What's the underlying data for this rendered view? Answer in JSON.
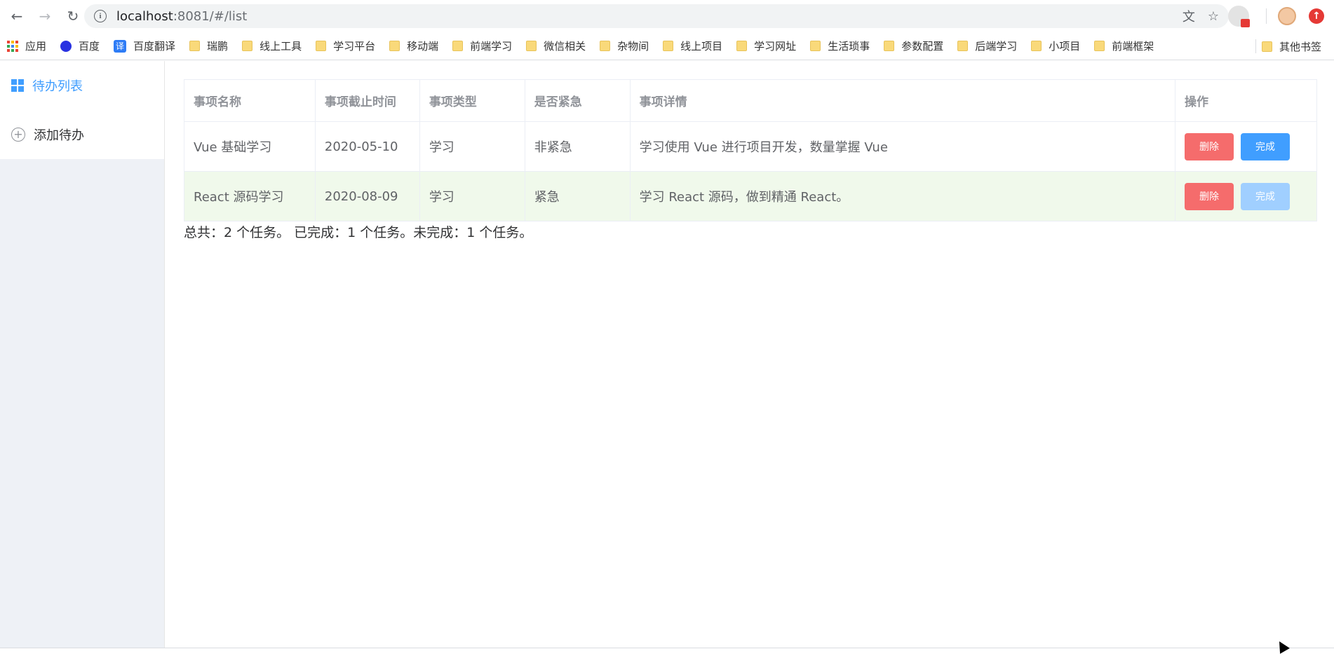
{
  "browser": {
    "url_host": "localhost",
    "url_rest": ":8081/#/list",
    "icons": [
      "back-icon",
      "forward-icon",
      "reload-icon",
      "info-icon",
      "translate-icon",
      "star-icon"
    ]
  },
  "bookmarks": {
    "apps": "应用",
    "items": [
      "百度",
      "百度翻译",
      "瑞鹏",
      "线上工具",
      "学习平台",
      "移动端",
      "前端学习",
      "微信相关",
      "杂物间",
      "线上项目",
      "学习网址",
      "生活琐事",
      "参数配置",
      "后端学习",
      "小项目",
      "前端框架"
    ],
    "other": "其他书签"
  },
  "sidebar": {
    "items": [
      {
        "label": "待办列表",
        "active": true
      },
      {
        "label": "添加待办",
        "active": false
      }
    ]
  },
  "table": {
    "headers": [
      "事项名称",
      "事项截止时间",
      "事项类型",
      "是否紧急",
      "事项详情",
      "操作"
    ],
    "rows": [
      {
        "name": "Vue 基础学习",
        "deadline": "2020-05-10",
        "type": "学习",
        "urgent": "非紧急",
        "detail": "学习使用 Vue 进行项目开发，数量掌握 Vue",
        "done": false
      },
      {
        "name": "React 源码学习",
        "deadline": "2020-08-09",
        "type": "学习",
        "urgent": "紧急",
        "detail": "学习 React 源码，做到精通 React。",
        "done": true
      }
    ],
    "delete_label": "删除",
    "complete_label": "完成"
  },
  "summary": "总共：2 个任务。 已完成：1 个任务。未完成：1 个任务。",
  "colors": {
    "primary": "#409eff",
    "danger": "#f56c6c",
    "success_row": "#f0f9eb"
  }
}
